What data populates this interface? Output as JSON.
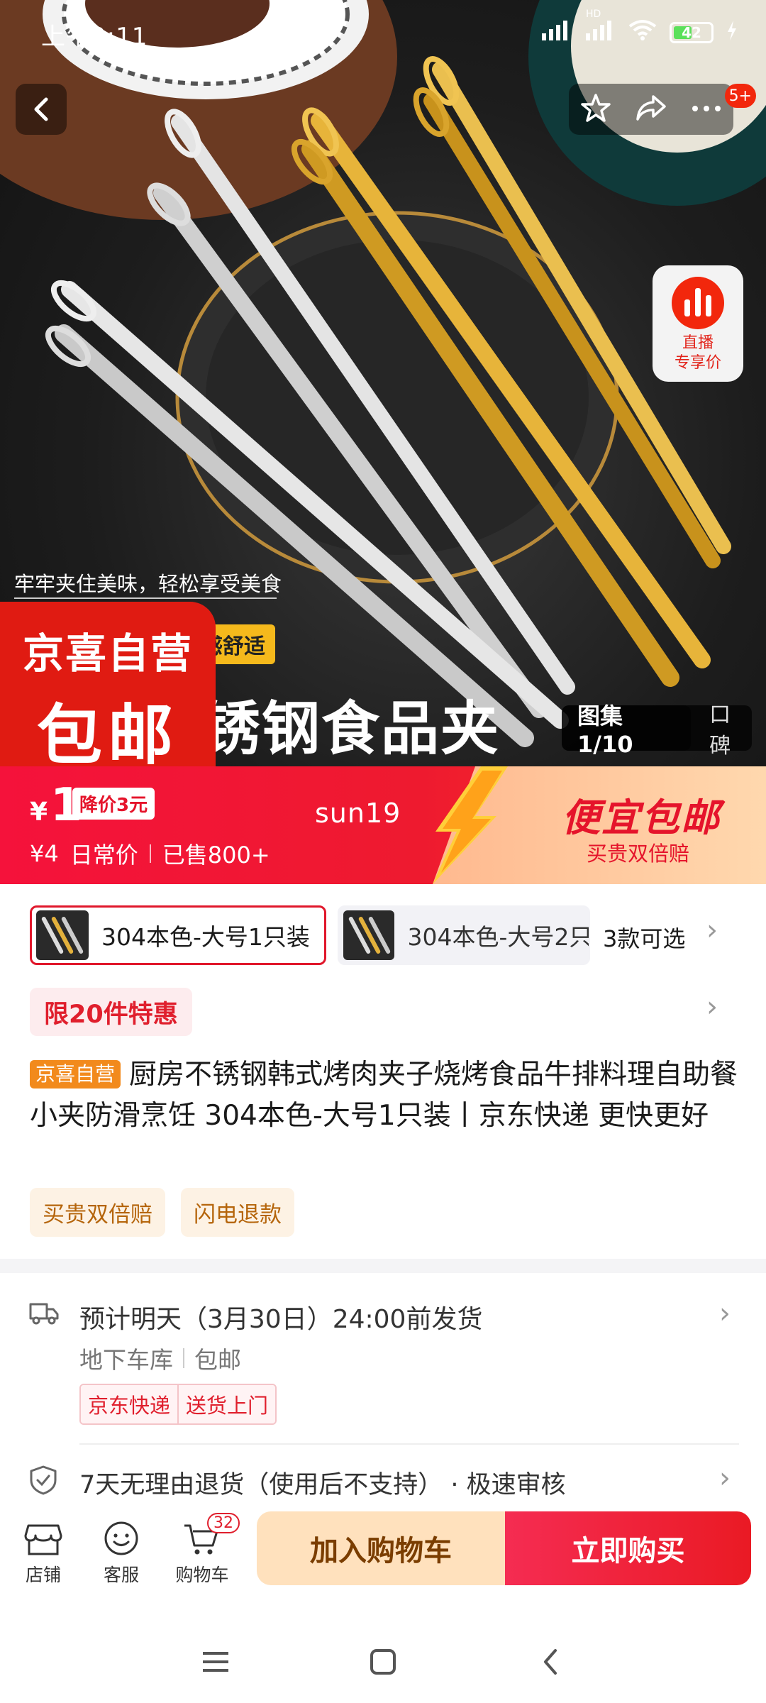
{
  "status_bar": {
    "time": "上午9:11",
    "battery": "42",
    "signal_label": "HD"
  },
  "top_bar": {
    "message_badge": "5+"
  },
  "hero": {
    "live": {
      "line1": "直播",
      "line2": "专享价"
    },
    "promo_caption": "牢牢夹住美味，轻松享受美食",
    "promo_yellow": "感舒适",
    "promo_big": "锈钢食品夹",
    "badge_line1": "京喜自营",
    "badge_line2": "包邮",
    "gallery": {
      "label": "图集1/10",
      "reviews": "口碑"
    }
  },
  "price": {
    "currency": "¥",
    "value": "1",
    "drop_tag": "降价3元",
    "regular": "¥4",
    "regular_label": "日常价",
    "sold": "已售800+",
    "username": "sun19",
    "slogan": "便宜包邮",
    "guarantee": "买贵双倍赔"
  },
  "sku": {
    "options": [
      {
        "label": "304本色-大号1只装",
        "selected": true
      },
      {
        "label": "304本色-大号2只",
        "selected": false
      }
    ],
    "count": "3款可选"
  },
  "limit_tag": "限20件特惠",
  "product": {
    "shop_tag": "京喜自营",
    "title": "厨房不锈钢韩式烤肉夹子烧烤食品牛排料理自助餐小夹防滑烹饪 304本色-大号1只装丨京东快递 更快更好",
    "service_tags": [
      "买贵双倍赔",
      "闪电退款"
    ]
  },
  "shipping": {
    "line1": "预计明天（3月30日）24:00前发货",
    "location": "地下车库",
    "free_shipping": "包邮",
    "tags": [
      "京东快递",
      "送货上门"
    ]
  },
  "returns": {
    "line": "7天无理由退货（使用后不支持） · 极速审核"
  },
  "action_bar": {
    "shop": "店铺",
    "service": "客服",
    "cart": "购物车",
    "cart_count": "32",
    "add_to_cart": "加入购物车",
    "buy_now": "立即购买"
  },
  "colors": {
    "accent_red": "#f2270c",
    "gold": "#e0a92a",
    "silver": "#d8d8d8"
  }
}
